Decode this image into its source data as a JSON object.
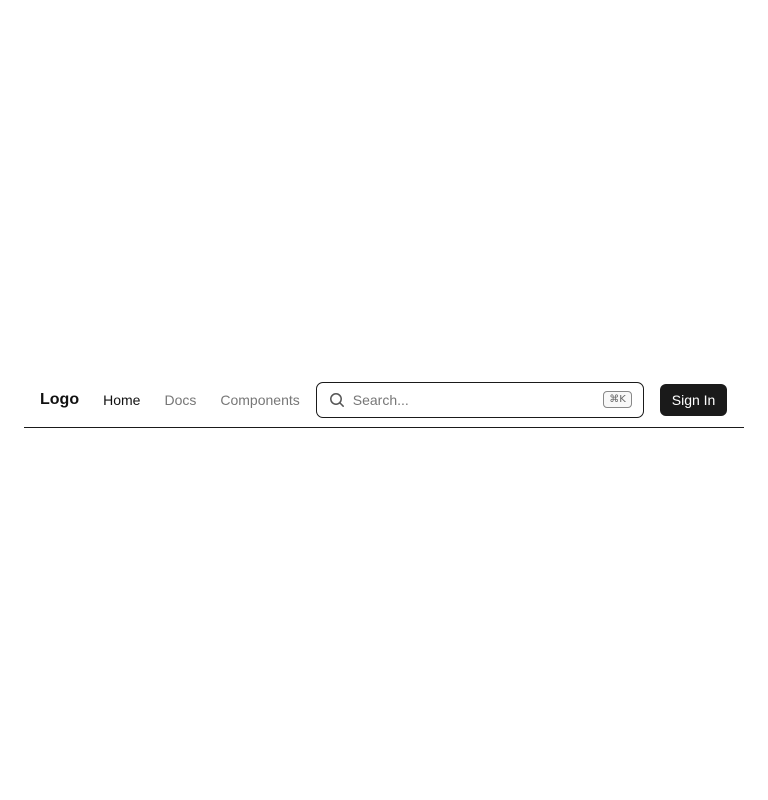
{
  "brand": {
    "logo": "Logo"
  },
  "nav": {
    "items": [
      {
        "label": "Home",
        "active": true
      },
      {
        "label": "Docs",
        "active": false
      },
      {
        "label": "Components",
        "active": false
      }
    ]
  },
  "search": {
    "placeholder": "Search...",
    "value": "",
    "shortcut": "⌘K",
    "icon": "search-icon"
  },
  "actions": {
    "sign_in_label": "Sign In"
  },
  "colors": {
    "primary": "#1a1a1a",
    "text": "#111111",
    "muted": "#777777",
    "background": "#ffffff"
  }
}
